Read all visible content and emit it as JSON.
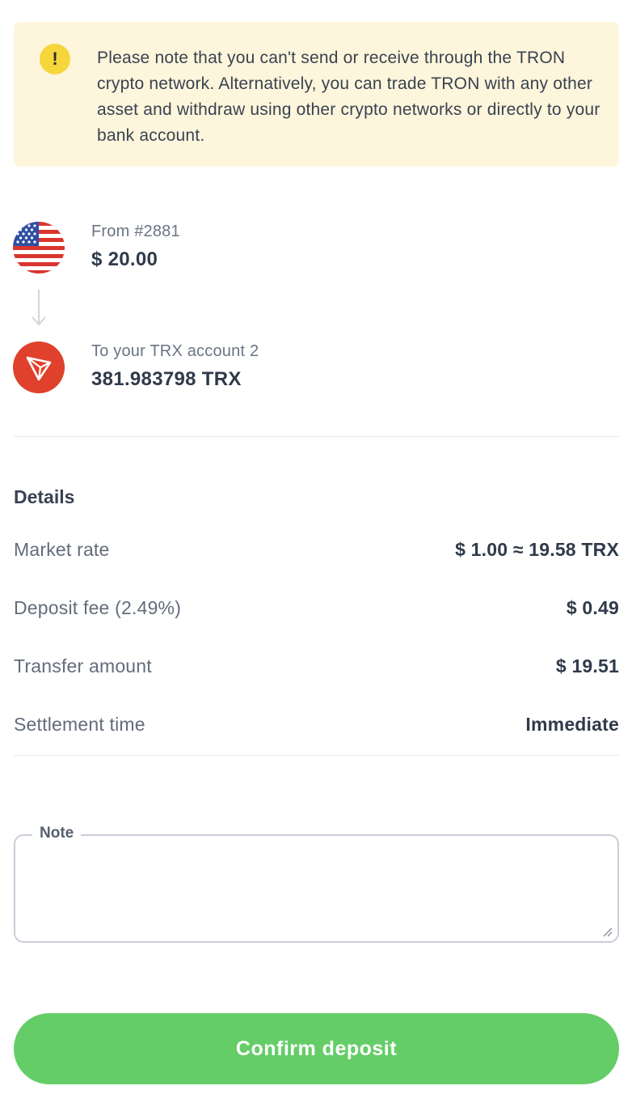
{
  "notice": {
    "icon": "exclamation-icon",
    "text": "Please note that you can't send or receive through the TRON crypto network. Alternatively, you can trade TRON with any other asset and withdraw using other crypto networks or directly to your bank account.",
    "background": "#fdf6dc",
    "icon_color": "#f6d63a"
  },
  "transfer": {
    "from": {
      "icon": "us-flag-icon",
      "label": "From #2881",
      "amount": "$ 20.00"
    },
    "arrow_icon": "arrow-down-icon",
    "to": {
      "icon": "tron-icon",
      "label": "To your TRX account 2",
      "amount": "381.983798 TRX",
      "icon_color": "#e0412c"
    }
  },
  "details": {
    "title": "Details",
    "rows": [
      {
        "label": "Market rate",
        "value": "$ 1.00 ≈ 19.58 TRX"
      },
      {
        "label": "Deposit fee (2.49%)",
        "value": "$ 0.49"
      },
      {
        "label": "Transfer amount",
        "value": "$ 19.51"
      },
      {
        "label": "Settlement time",
        "value": "Immediate"
      }
    ]
  },
  "note": {
    "label": "Note",
    "value": ""
  },
  "confirm": {
    "label": "Confirm deposit",
    "color": "#65cd67"
  }
}
